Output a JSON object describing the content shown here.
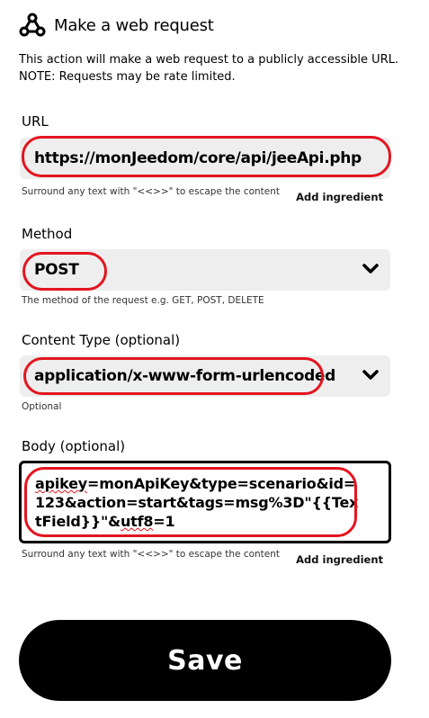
{
  "header": {
    "icon": "webhooks-icon",
    "title": "Make a web request"
  },
  "description": "This action will make a web request to a publicly accessible URL. NOTE: Requests may be rate limited.",
  "url": {
    "label": "URL",
    "value": "https://monJeedom/core/api/jeeApi.php",
    "hint": "Surround any text with \"<<>>\" to escape the content",
    "ingredient": "Add ingredient"
  },
  "method": {
    "label": "Method",
    "value": "POST",
    "hint": "The method of the request e.g. GET, POST, DELETE"
  },
  "content_type": {
    "label": "Content Type (optional)",
    "value": "application/x-www-form-urlencoded",
    "hint": "Optional"
  },
  "body": {
    "label": "Body (optional)",
    "value_part1": "apikey",
    "value_part2": "=monApiKey&type=scenario&id=123&action=start&tags=msg%3D\"{{TextField}}\"&",
    "value_part3": "utf8",
    "value_part4": "=1",
    "hint": "Surround any text with \"<<>>\" to escape the content",
    "ingredient": "Add ingredient"
  },
  "save_label": "Save",
  "colors": {
    "highlight": "#e3151f",
    "field_bg": "#eeeeee",
    "button": "#000000"
  }
}
